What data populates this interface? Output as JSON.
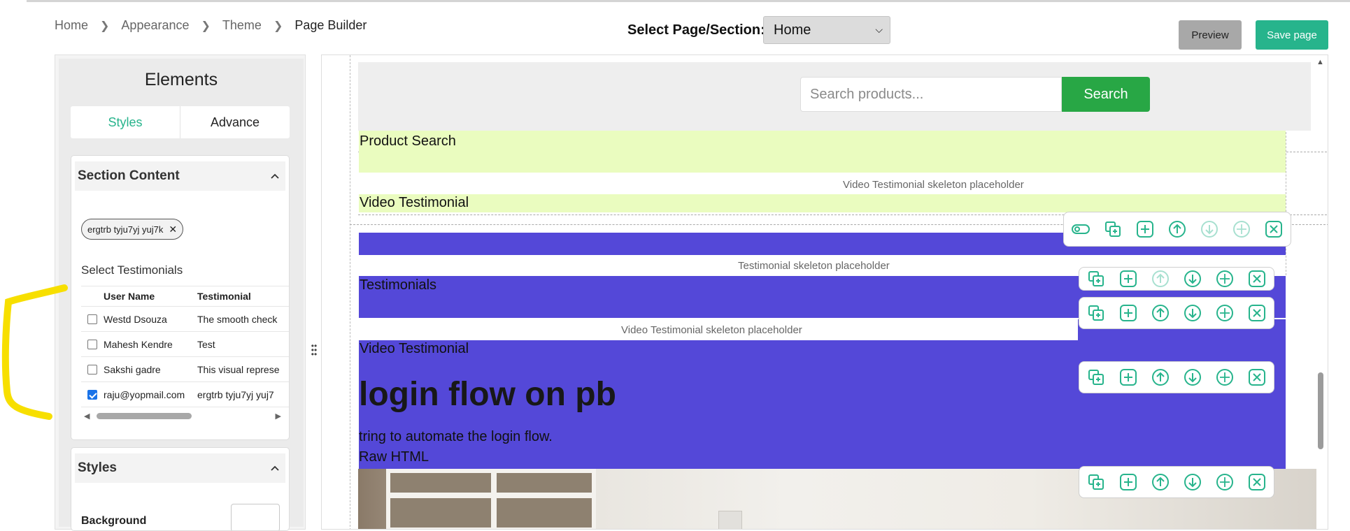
{
  "breadcrumb": [
    "Home",
    "Appearance",
    "Theme",
    "Page Builder"
  ],
  "header": {
    "select_label": "Select Page/Section:",
    "select_value": "Home",
    "preview_label": "Preview",
    "save_label": "Save page"
  },
  "colors": {
    "accent": "#27b48c",
    "search_button": "#28a745",
    "section_purple": "#5448d8",
    "lime": "#eafcbf"
  },
  "left_panel": {
    "title": "Elements",
    "tabs": [
      "Styles",
      "Advance"
    ],
    "active_tab": "Styles",
    "section_content": {
      "heading": "Section Content",
      "chip": "ergtrb tyju7yj yuj7k",
      "select_label": "Select Testimonials",
      "columns": [
        "User Name",
        "Testimonial"
      ],
      "rows": [
        {
          "name": "Westd Dsouza",
          "testimonial": "The smooth check",
          "checked": false
        },
        {
          "name": "Mahesh Kendre",
          "testimonial": "Test",
          "checked": false
        },
        {
          "name": "Sakshi gadre",
          "testimonial": "This visual represe",
          "checked": false
        },
        {
          "name": "raju@yopmail.com",
          "testimonial": "ergtrb tyju7yj yuj7",
          "checked": true
        }
      ]
    },
    "styles": {
      "heading": "Styles",
      "background_label": "Background"
    }
  },
  "canvas": {
    "search_placeholder": "Search products...",
    "search_button": "Search",
    "product_search_label": "Product Search",
    "video_placeholder": "Video Testimonial skeleton placeholder",
    "video_label": "Video Testimonial",
    "testimonial_placeholder": "Testimonial skeleton placeholder",
    "testimonials_label": "Testimonials",
    "video_placeholder_2": "Video Testimonial skeleton placeholder",
    "video_label_2": "Video Testimonial",
    "login_heading": "login flow on pb",
    "login_text": "tring to automate the login flow.",
    "raw_html_label": "Raw HTML"
  },
  "toolbar_icons": [
    "toggle-icon",
    "duplicate-icon",
    "add-icon",
    "move-up-icon",
    "move-down-icon",
    "move-icon",
    "close-icon"
  ]
}
